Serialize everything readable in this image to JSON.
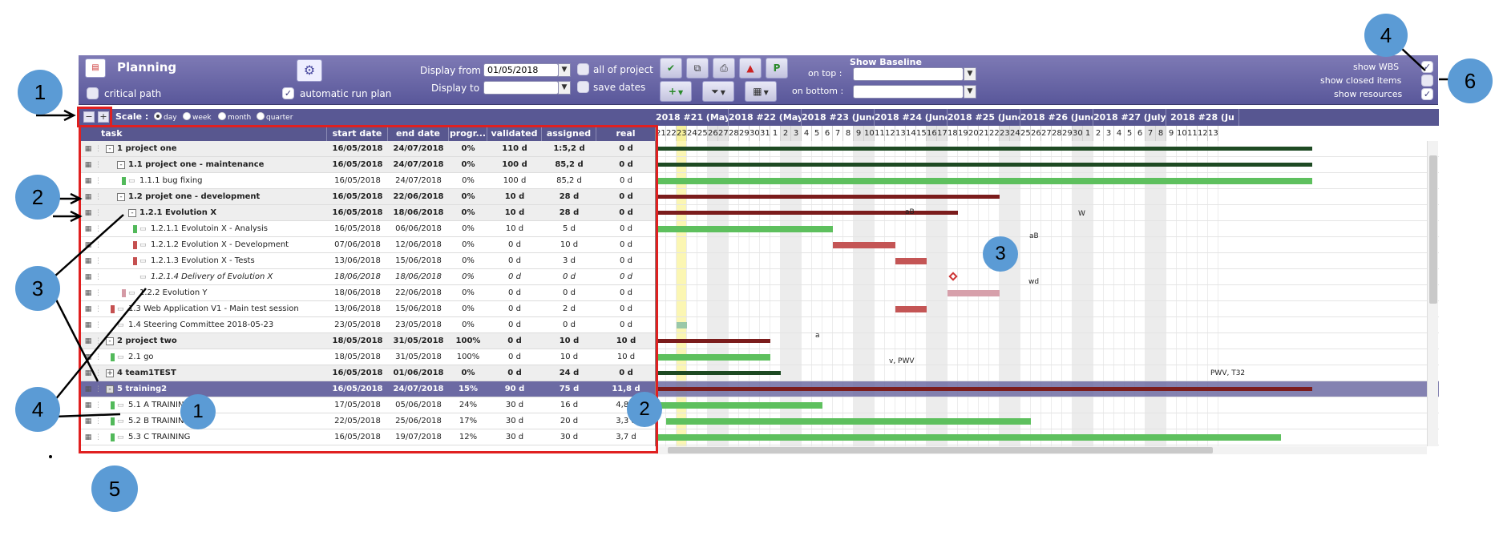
{
  "toolbar": {
    "title": "Planning",
    "critical_path_label": "critical path",
    "automatic_run_plan_label": "automatic run plan",
    "display_from_label": "Display from",
    "display_from_value": "01/05/2018",
    "display_to_label": "Display to",
    "display_to_value": "",
    "all_of_project_label": "all of project",
    "save_dates_label": "save dates",
    "show_baseline_label": "Show Baseline",
    "on_top_label": "on top :",
    "on_bottom_label": "on bottom :",
    "show_wbs_label": "show WBS",
    "show_closed_items_label": "show closed items",
    "show_resources_label": "show resources"
  },
  "scale": {
    "label": "Scale :",
    "options": [
      "day",
      "week",
      "month",
      "quarter"
    ],
    "selected": "day"
  },
  "columns": [
    "task",
    "start date",
    "end date",
    "progr...",
    "validated",
    "assigned",
    "real"
  ],
  "rows": [
    {
      "name": "1 project one",
      "start": "16/05/2018",
      "end": "24/07/2018",
      "progress": "0%",
      "validated": "110 d",
      "assigned": "1:5,2 d",
      "real": "0 d",
      "style": "grp"
    },
    {
      "name": "1.1 project one - maintenance",
      "start": "16/05/2018",
      "end": "24/07/2018",
      "progress": "0%",
      "validated": "100 d",
      "assigned": "85,2 d",
      "real": "0 d",
      "style": "grp"
    },
    {
      "name": "1.1.1 bug fixing",
      "start": "16/05/2018",
      "end": "24/07/2018",
      "progress": "0%",
      "validated": "100 d",
      "assigned": "85,2 d",
      "real": "0 d",
      "style": "task"
    },
    {
      "name": "1.2 projet one - development",
      "start": "16/05/2018",
      "end": "22/06/2018",
      "progress": "0%",
      "validated": "10 d",
      "assigned": "28 d",
      "real": "0 d",
      "style": "grp"
    },
    {
      "name": "1.2.1 Evolution X",
      "start": "16/05/2018",
      "end": "18/06/2018",
      "progress": "0%",
      "validated": "10 d",
      "assigned": "28 d",
      "real": "0 d",
      "style": "grp"
    },
    {
      "name": "1.2.1.1 Evolutoin X - Analysis",
      "start": "16/05/2018",
      "end": "06/06/2018",
      "progress": "0%",
      "validated": "10 d",
      "assigned": "5 d",
      "real": "0 d",
      "style": "task"
    },
    {
      "name": "1.2.1.2 Evolution X - Development",
      "start": "07/06/2018",
      "end": "12/06/2018",
      "progress": "0%",
      "validated": "0 d",
      "assigned": "10 d",
      "real": "0 d",
      "style": "task"
    },
    {
      "name": "1.2.1.3 Evolution X - Tests",
      "start": "13/06/2018",
      "end": "15/06/2018",
      "progress": "0%",
      "validated": "0 d",
      "assigned": "3 d",
      "real": "0 d",
      "style": "task"
    },
    {
      "name": "1.2.1.4 Delivery of Evolution X",
      "start": "18/06/2018",
      "end": "18/06/2018",
      "progress": "0%",
      "validated": "0 d",
      "assigned": "0 d",
      "real": "0 d",
      "style": "milestone"
    },
    {
      "name": "1.2.2 Evolution Y",
      "start": "18/06/2018",
      "end": "22/06/2018",
      "progress": "0%",
      "validated": "0 d",
      "assigned": "0 d",
      "real": "0 d",
      "style": "task"
    },
    {
      "name": "1.3 Web Application V1 - Main test session",
      "start": "13/06/2018",
      "end": "15/06/2018",
      "progress": "0%",
      "validated": "0 d",
      "assigned": "2 d",
      "real": "0 d",
      "style": "task"
    },
    {
      "name": "1.4 Steering Committee 2018-05-23",
      "start": "23/05/2018",
      "end": "23/05/2018",
      "progress": "0%",
      "validated": "0 d",
      "assigned": "0 d",
      "real": "0 d",
      "style": "task"
    },
    {
      "name": "2 project two",
      "start": "18/05/2018",
      "end": "31/05/2018",
      "progress": "100%",
      "validated": "0 d",
      "assigned": "10 d",
      "real": "10 d",
      "style": "grp"
    },
    {
      "name": "2.1 go",
      "start": "18/05/2018",
      "end": "31/05/2018",
      "progress": "100%",
      "validated": "0 d",
      "assigned": "10 d",
      "real": "10 d",
      "style": "task"
    },
    {
      "name": "4 team1TEST",
      "start": "16/05/2018",
      "end": "01/06/2018",
      "progress": "0%",
      "validated": "0 d",
      "assigned": "24 d",
      "real": "0 d",
      "style": "grp"
    },
    {
      "name": "5 training2",
      "start": "16/05/2018",
      "end": "24/07/2018",
      "progress": "15%",
      "validated": "90 d",
      "assigned": "75 d",
      "real": "11,8 d",
      "style": "sel"
    },
    {
      "name": "5.1 A TRAINING",
      "start": "17/05/2018",
      "end": "05/06/2018",
      "progress": "24%",
      "validated": "30 d",
      "assigned": "16 d",
      "real": "4,8 d",
      "style": "task"
    },
    {
      "name": "5.2 B TRAINING",
      "start": "22/05/2018",
      "end": "25/06/2018",
      "progress": "17%",
      "validated": "30 d",
      "assigned": "20 d",
      "real": "3,3 d",
      "style": "task"
    },
    {
      "name": "5.3 C TRAINING",
      "start": "16/05/2018",
      "end": "19/07/2018",
      "progress": "12%",
      "validated": "30 d",
      "assigned": "30 d",
      "real": "3,7 d",
      "style": "task"
    }
  ],
  "gantt": {
    "weeks": [
      "2018 #21 (May)",
      "2018 #22 (May)",
      "2018 #23 (June)",
      "2018 #24 (June)",
      "2018 #25 (June)",
      "2018 #26 (June)",
      "2018 #27 (July)",
      "2018 #28 (Ju"
    ],
    "days": [
      "21",
      "22",
      "23",
      "24",
      "25",
      "26",
      "27",
      "28",
      "29",
      "30",
      "31",
      "1",
      "2",
      "3",
      "4",
      "5",
      "6",
      "7",
      "8",
      "9",
      "10",
      "11",
      "12",
      "13",
      "14",
      "15",
      "16",
      "17",
      "18",
      "19",
      "20",
      "21",
      "22",
      "23",
      "24",
      "25",
      "26",
      "27",
      "28",
      "29",
      "30",
      "1",
      "2",
      "3",
      "4",
      "5",
      "6",
      "7",
      "8",
      "9",
      "10",
      "11",
      "12",
      "13"
    ],
    "bar_labels": [
      "W",
      "aB",
      "aB",
      "wd",
      "a",
      "v, PWV",
      "PWV, T32"
    ]
  },
  "callouts": [
    "1",
    "2",
    "3",
    "4",
    "5",
    "6",
    "4",
    "1",
    "2",
    "3",
    "1",
    "2",
    "3",
    "4"
  ]
}
